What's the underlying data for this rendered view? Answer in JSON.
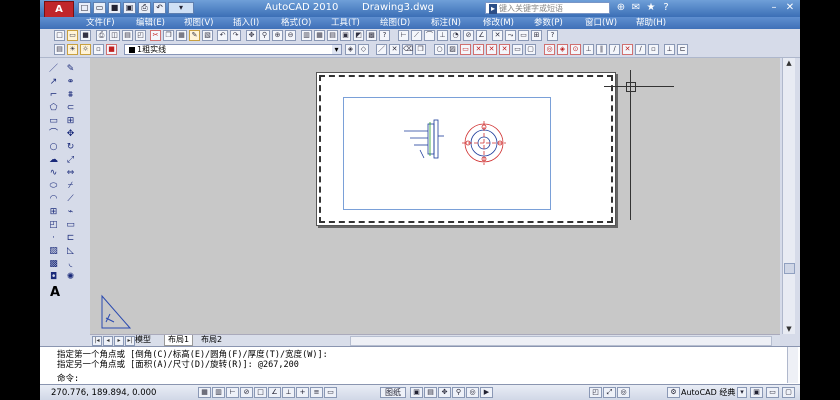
{
  "titlebar": {
    "app_logo": "A",
    "app_title": "AutoCAD 2010",
    "doc_title": "Drawing3.dwg",
    "search_placeholder": "键入关键字或短语"
  },
  "menu": [
    {
      "label": "文件(F)"
    },
    {
      "label": "编辑(E)"
    },
    {
      "label": "视图(V)"
    },
    {
      "label": "插入(I)"
    },
    {
      "label": "格式(O)"
    },
    {
      "label": "工具(T)"
    },
    {
      "label": "绘图(D)"
    },
    {
      "label": "标注(N)"
    },
    {
      "label": "修改(M)"
    },
    {
      "label": "参数(P)"
    },
    {
      "label": "窗口(W)"
    },
    {
      "label": "帮助(H)"
    }
  ],
  "layer": {
    "current": "1粗实线"
  },
  "side_toolbar": {
    "text_tool": "A"
  },
  "tabs": [
    {
      "label": "模型"
    },
    {
      "label": "布局1"
    },
    {
      "label": "布局2"
    }
  ],
  "command": {
    "line1": "指定第一个角点或 [倒角(C)/标高(E)/圆角(F)/厚度(T)/宽度(W)]:",
    "line2": "指定另一个角点或 [面积(A)/尺寸(D)/旋转(R)]: @267,200",
    "prompt": "命令:"
  },
  "status": {
    "coordinates": "270.776, 189.894, 0.000",
    "paper_label": "图纸",
    "workspace": "AutoCAD 经典"
  },
  "colors": {
    "titlebar": "#3b6fb6",
    "canvas": "#c8c8c8",
    "viewport_border": "#7aa0d8",
    "flange_red": "#d03030"
  }
}
